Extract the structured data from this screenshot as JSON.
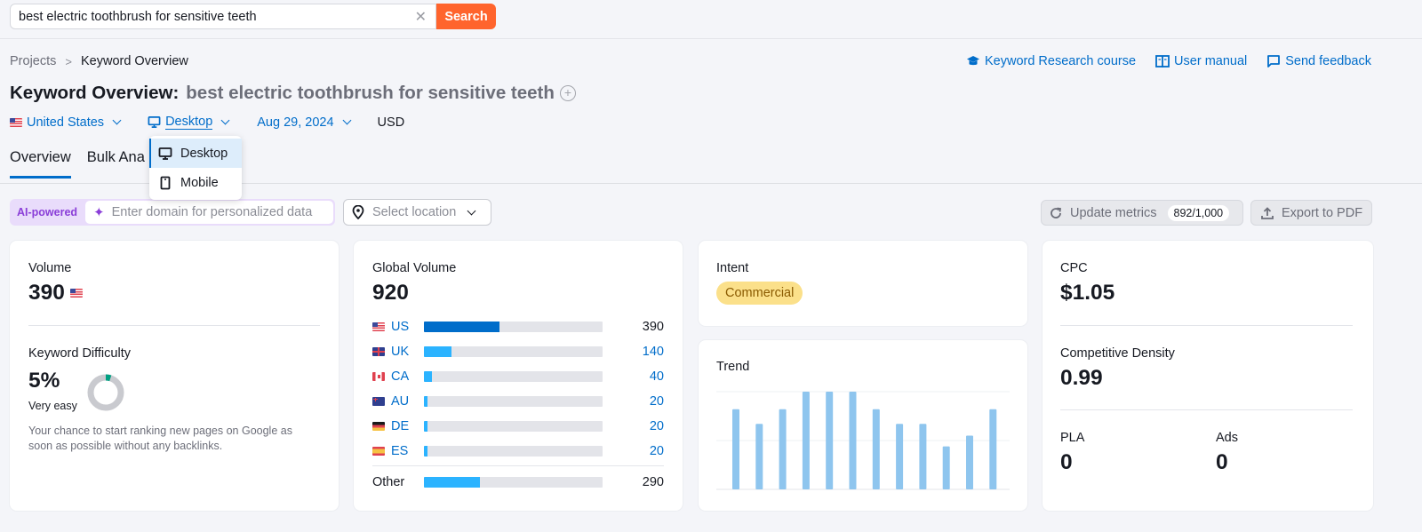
{
  "search": {
    "value": "best electric toothbrush for sensitive teeth",
    "clear_icon": "close-icon",
    "button_label": "Search"
  },
  "breadcrumb": {
    "items": [
      "Projects",
      "Keyword Overview"
    ]
  },
  "top_links": [
    {
      "label": "Keyword Research course",
      "icon": "graduation-cap-icon"
    },
    {
      "label": "User manual",
      "icon": "book-icon"
    },
    {
      "label": "Send feedback",
      "icon": "feedback-icon"
    }
  ],
  "header": {
    "title": "Keyword Overview:",
    "keyword": "best electric toothbrush for sensitive teeth",
    "add_icon": "add-icon"
  },
  "filters": {
    "country": "United States",
    "device": "Desktop",
    "date": "Aug 29, 2024",
    "currency": "USD"
  },
  "device_dropdown": {
    "options": [
      {
        "label": "Desktop",
        "selected": true
      },
      {
        "label": "Mobile",
        "selected": false
      }
    ]
  },
  "tabs": [
    {
      "label": "Overview",
      "active": true
    },
    {
      "label": "Bulk Analysis",
      "active": false
    }
  ],
  "tabs_visible": {
    "bulk": "Bulk Ana"
  },
  "toolbar": {
    "ai_label": "AI-powered",
    "domain_placeholder": "Enter domain for personalized data",
    "location_placeholder": "Select location",
    "update_label": "Update metrics",
    "update_count": "892/1,000",
    "export_label": "Export to PDF"
  },
  "volume_card": {
    "volume_label": "Volume",
    "volume_value": "390",
    "kd_label": "Keyword Difficulty",
    "kd_value": "5%",
    "kd_percent": 5,
    "kd_rating": "Very easy",
    "kd_note": "Your chance to start ranking new pages on Google as soon as possible without any backlinks.",
    "kd_color": "#009f81"
  },
  "global_volume_card": {
    "label": "Global Volume",
    "total": "920",
    "total_value": 920,
    "countries": [
      {
        "code": "US",
        "flag": "us",
        "value": 390,
        "display": "390"
      },
      {
        "code": "UK",
        "flag": "uk",
        "value": 140,
        "display": "140"
      },
      {
        "code": "CA",
        "flag": "ca",
        "value": 40,
        "display": "40"
      },
      {
        "code": "AU",
        "flag": "au",
        "value": 20,
        "display": "20"
      },
      {
        "code": "DE",
        "flag": "de",
        "value": 20,
        "display": "20"
      },
      {
        "code": "ES",
        "flag": "es",
        "value": 20,
        "display": "20"
      }
    ],
    "other": {
      "label": "Other",
      "value": 290,
      "display": "290"
    }
  },
  "intent_card": {
    "label": "Intent",
    "value": "Commercial"
  },
  "trend_card": {
    "label": "Trend",
    "relative_values": [
      0.82,
      0.67,
      0.82,
      1.0,
      1.0,
      1.0,
      0.82,
      0.67,
      0.67,
      0.44,
      0.55,
      0.82
    ]
  },
  "cpc_card": {
    "cpc_label": "CPC",
    "cpc_value": "$1.05",
    "density_label": "Competitive Density",
    "density_value": "0.99",
    "pla_label": "PLA",
    "pla_value": "0",
    "ads_label": "Ads",
    "ads_value": "0"
  },
  "colors": {
    "accent": "#006dca",
    "search_button": "#ff642d",
    "ai_purple": "#8a3ed8",
    "intent_commercial": "#fbe08a",
    "trend_bar": "#8ec5ee",
    "bar_primary": "#006dca",
    "bar_secondary": "#2bb3ff"
  }
}
